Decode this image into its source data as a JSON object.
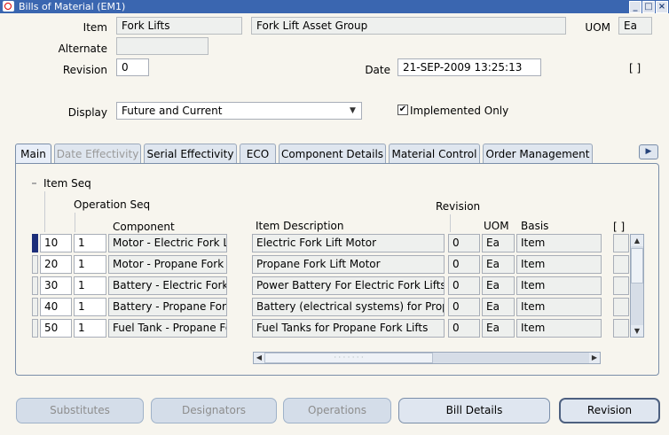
{
  "window": {
    "title": "Bills of Material (EM1)"
  },
  "header": {
    "item_label": "Item",
    "item_value": "Fork Lifts",
    "item_desc": "Fork Lift Asset Group",
    "uom_label": "UOM",
    "uom_value": "Ea",
    "alternate_label": "Alternate",
    "alternate_value": "",
    "revision_label": "Revision",
    "revision_value": "0",
    "date_label": "Date",
    "date_value": "21-SEP-2009 13:25:13",
    "flex_label": "[ ]",
    "display_label": "Display",
    "display_value": "Future and Current",
    "implemented_label": "Implemented Only",
    "implemented_checked": true
  },
  "tabs": [
    {
      "label": "Main",
      "active": true
    },
    {
      "label": "Date Effectivity",
      "disabled": true
    },
    {
      "label": "Serial Effectivity"
    },
    {
      "label": "ECO"
    },
    {
      "label": "Component Details"
    },
    {
      "label": "Material Control"
    },
    {
      "label": "Order Management"
    }
  ],
  "grid": {
    "item_seq_label": "Item Seq",
    "operation_seq_label": "Operation Seq",
    "component_label": "Component",
    "item_description_label": "Item Description",
    "revision_label": "Revision",
    "uom_label": "UOM",
    "basis_label": "Basis",
    "flex_label": "[ ]",
    "rows": [
      {
        "item_seq": "10",
        "op_seq": "1",
        "component": "Motor - Electric Fork Lift",
        "description": "Electric Fork Lift Motor",
        "revision": "0",
        "uom": "Ea",
        "basis": "Item"
      },
      {
        "item_seq": "20",
        "op_seq": "1",
        "component": "Motor - Propane Fork Lift",
        "description": "Propane Fork Lift Motor",
        "revision": "0",
        "uom": "Ea",
        "basis": "Item"
      },
      {
        "item_seq": "30",
        "op_seq": "1",
        "component": "Battery - Electric Fork Lift",
        "description": "Power Battery For Electric Fork Lifts",
        "revision": "0",
        "uom": "Ea",
        "basis": "Item"
      },
      {
        "item_seq": "40",
        "op_seq": "1",
        "component": "Battery - Propane Fork Lift",
        "description": "Battery (electrical systems) for Propane",
        "revision": "0",
        "uom": "Ea",
        "basis": "Item"
      },
      {
        "item_seq": "50",
        "op_seq": "1",
        "component": "Fuel Tank - Propane Fork Lift",
        "description": "Fuel Tanks for Propane Fork Lifts",
        "revision": "0",
        "uom": "Ea",
        "basis": "Item"
      }
    ]
  },
  "buttons": {
    "substitutes": "Substitutes",
    "designators": "Designators",
    "operations": "Operations",
    "bill_details": "Bill Details",
    "revision": "Revision"
  },
  "colors": {
    "titlebar": "#3a66b0",
    "current_record": "#1c2e7a",
    "tab": "#dfe6ef"
  }
}
